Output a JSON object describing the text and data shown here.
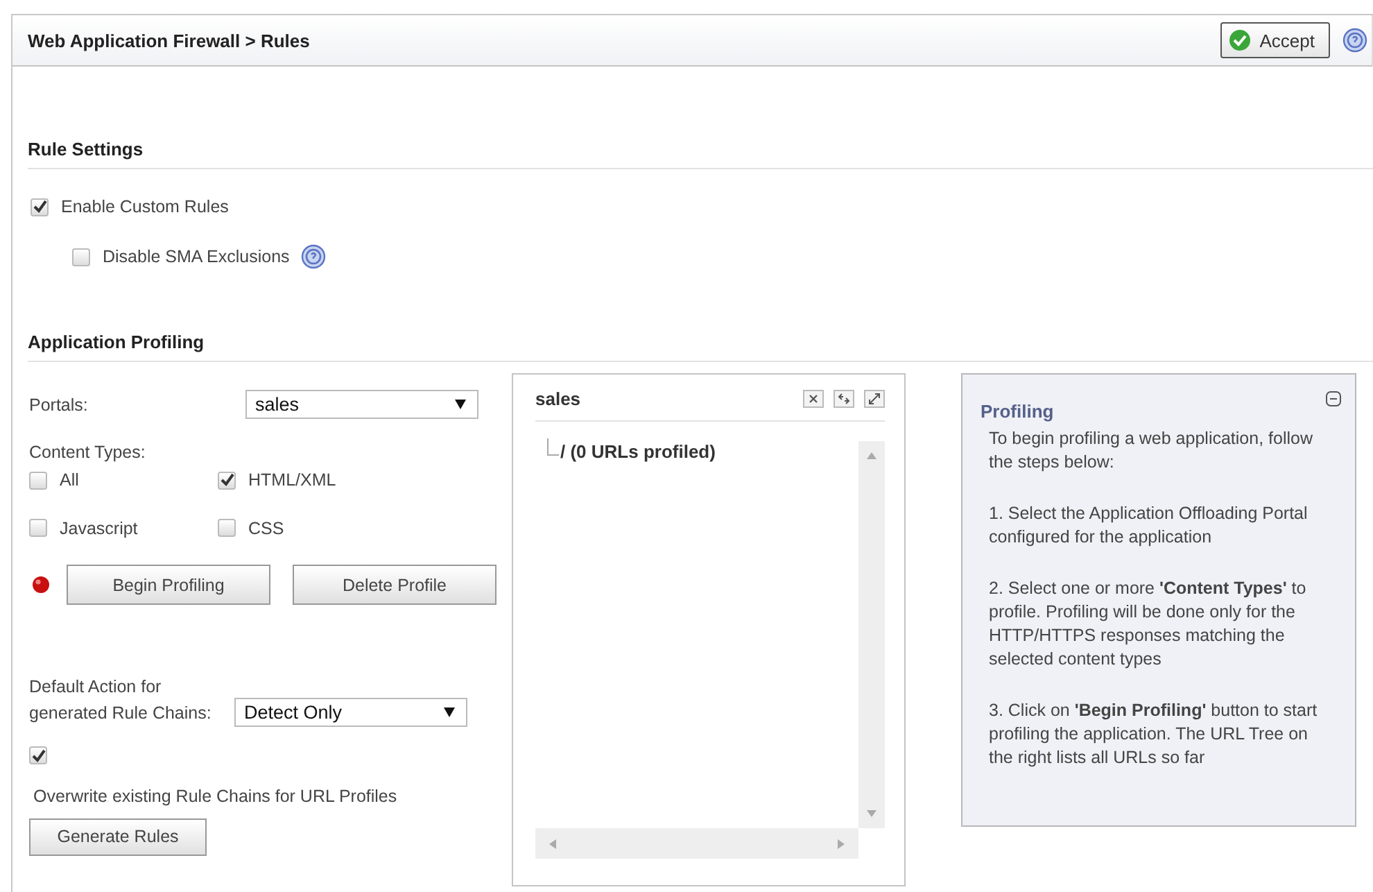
{
  "header": {
    "title": "Web Application Firewall > Rules",
    "accept_button": "Accept"
  },
  "rule_settings": {
    "heading": "Rule Settings",
    "options": [
      {
        "label": "Enable Custom Rules",
        "checked": true,
        "indented": false,
        "help": false
      },
      {
        "label": "Disable SMA Exclusions",
        "checked": false,
        "indented": true,
        "help": true
      }
    ]
  },
  "application_profiling": {
    "heading": "Application Profiling",
    "portals_label": "Portals:",
    "portals_value": "sales",
    "content_types_label": "Content Types:",
    "content_types": [
      {
        "label": "All",
        "checked": false
      },
      {
        "label": "HTML/XML",
        "checked": true
      },
      {
        "label": "Javascript",
        "checked": false
      },
      {
        "label": "CSS",
        "checked": false
      }
    ],
    "begin_button": "Begin Profiling",
    "delete_button": "Delete Profile",
    "default_action_label": "Default Action for generated Rule Chains:",
    "default_action_value": "Detect Only",
    "overwrite": {
      "label": "Overwrite existing Rule Chains for URL Profiles",
      "checked": true
    },
    "generate_button": "Generate Rules"
  },
  "url_tree": {
    "title": "sales",
    "root": "/ (0 URLs profiled)"
  },
  "help_panel": {
    "title": "Profiling",
    "paragraphs": [
      "To begin profiling a web application, follow the steps below:",
      "1. Select the Application Offloading Portal configured for the application",
      "2. Select one or more **'Content Types'** to profile. Profiling will be done only for the HTTP/HTTPS responses matching the selected content types",
      "3. Click on **'Begin Profiling'** button to start profiling the application. The URL Tree on the right lists all URLs so far"
    ]
  }
}
